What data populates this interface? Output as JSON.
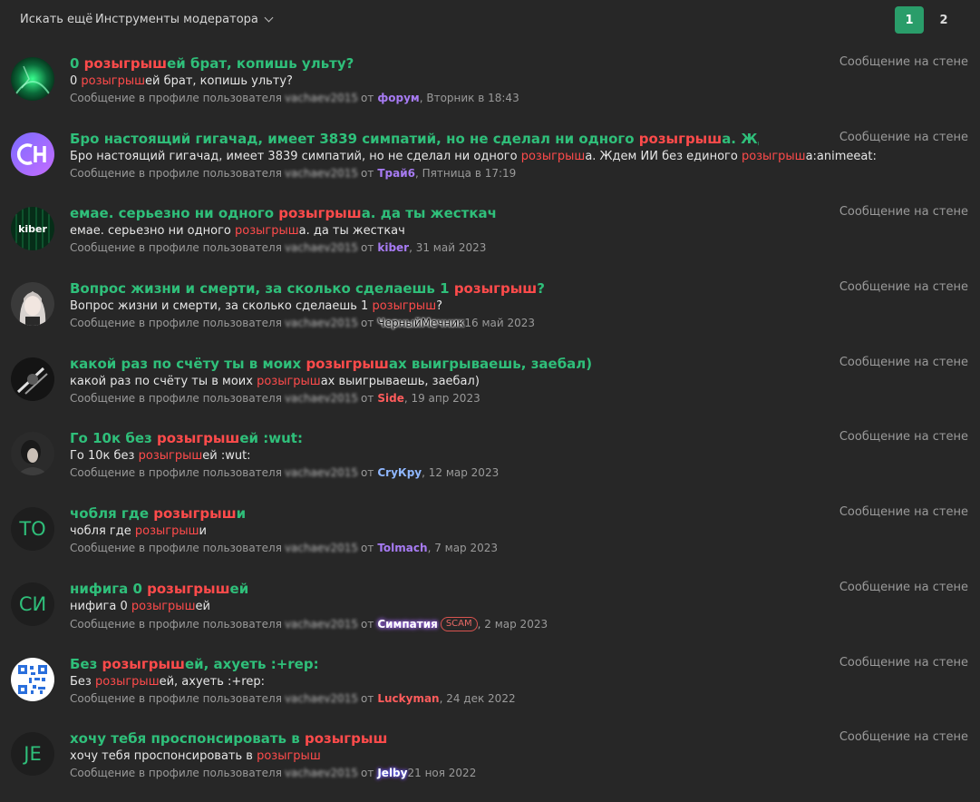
{
  "toolbar": {
    "search_more": "Искать ещё",
    "moderator_tools": "Инструменты модератора",
    "pages": [
      "1",
      "2"
    ]
  },
  "meta_labels": {
    "profile_message": "Сообщение в профиле пользователя",
    "owner": "vachaev2015",
    "from": "от",
    "type": "Сообщение на стене"
  },
  "avatars": {
    "letters": [
      "ТО",
      "СИ",
      "JE"
    ],
    "kiber": "kiber",
    "ch": "CH"
  },
  "results": [
    {
      "title": [
        "0 ",
        "розыгрыш",
        "ей брат, копишь ульту?"
      ],
      "snippet": [
        "0 ",
        "розыгрыш",
        "ей брат, копишь ульту?"
      ],
      "author": "форум",
      "date": ", Вторник в 18:43"
    },
    {
      "title": [
        "Бро настоящий гигачад, имеет 3839 симпатий, но не сделал ни одного ",
        "розыгрыш",
        "а. Ждем ИИ без..."
      ],
      "snippet": [
        "Бро настоящий гигачад, имеет 3839 симпатий, но не сделал ни одного ",
        "розыгрыш",
        "а. Ждем ИИ без единого ",
        "розыгрыш",
        "а:animeeat:"
      ],
      "author": "Трай6",
      "date": ", Пятница в 17:19"
    },
    {
      "title": [
        "емае. серьезно ни одного ",
        "розыгрыш",
        "а. да ты жесткач"
      ],
      "snippet": [
        "емае. серьезно ни одного ",
        "розыгрыш",
        "а. да ты жесткач"
      ],
      "author": "kiber",
      "date": ", 31 май 2023"
    },
    {
      "title": [
        "Вопрос жизни и смерти, за сколько сделаешь 1 ",
        "розыгрыш",
        "?"
      ],
      "snippet": [
        "Вопрос жизни и смерти, за сколько сделаешь 1 ",
        "розыгрыш",
        "?"
      ],
      "author": "ЧерныйМечник",
      "date": " 16 май 2023"
    },
    {
      "title": [
        "какой раз по счёту ты в моих ",
        "розыгрыш",
        "ах выигрываешь, заебал)"
      ],
      "snippet": [
        "какой раз по счёту ты в моих ",
        "розыгрыш",
        "ах выигрываешь, заебал)"
      ],
      "author": "Side",
      "date": ", 19 апр 2023"
    },
    {
      "title": [
        "Го 10к без ",
        "розыгрыш",
        "ей :wut:"
      ],
      "snippet": [
        "Го 10к без ",
        "розыгрыш",
        "ей :wut:"
      ],
      "author": "CryКру",
      "date": ", 12 мар 2023"
    },
    {
      "title": [
        "чобля где ",
        "розыгрыш",
        "и"
      ],
      "snippet": [
        "чобля где ",
        "розыгрыш",
        "и"
      ],
      "author": "Tolmach",
      "date": ", 7 мар 2023"
    },
    {
      "title": [
        "нифига 0 ",
        "розыгрыш",
        "ей"
      ],
      "snippet": [
        "нифига 0 ",
        "розыгрыш",
        "ей"
      ],
      "author": "Симпатия",
      "badge": "SCAM",
      "date": " , 2 мар 2023"
    },
    {
      "title": [
        "Без ",
        "розыгрыш",
        "ей, ахуеть :+rep:"
      ],
      "snippet": [
        "Без ",
        "розыгрыш",
        "ей, ахуеть :+rep:"
      ],
      "author": "Luckyman",
      "date": ", 24 дек 2022"
    },
    {
      "title": [
        "хочу тебя проспонсировать в ",
        "розыгрыш"
      ],
      "snippet": [
        "хочу тебя проспонсировать в ",
        "розыгрыш"
      ],
      "author": "Jelby",
      "date": " 21 ноя 2022"
    }
  ],
  "colors": {
    "accent_green": "#2fbf7a",
    "highlight_red": "#ff4b4b",
    "active_page": "#2a9d6a",
    "background": "#272727"
  }
}
